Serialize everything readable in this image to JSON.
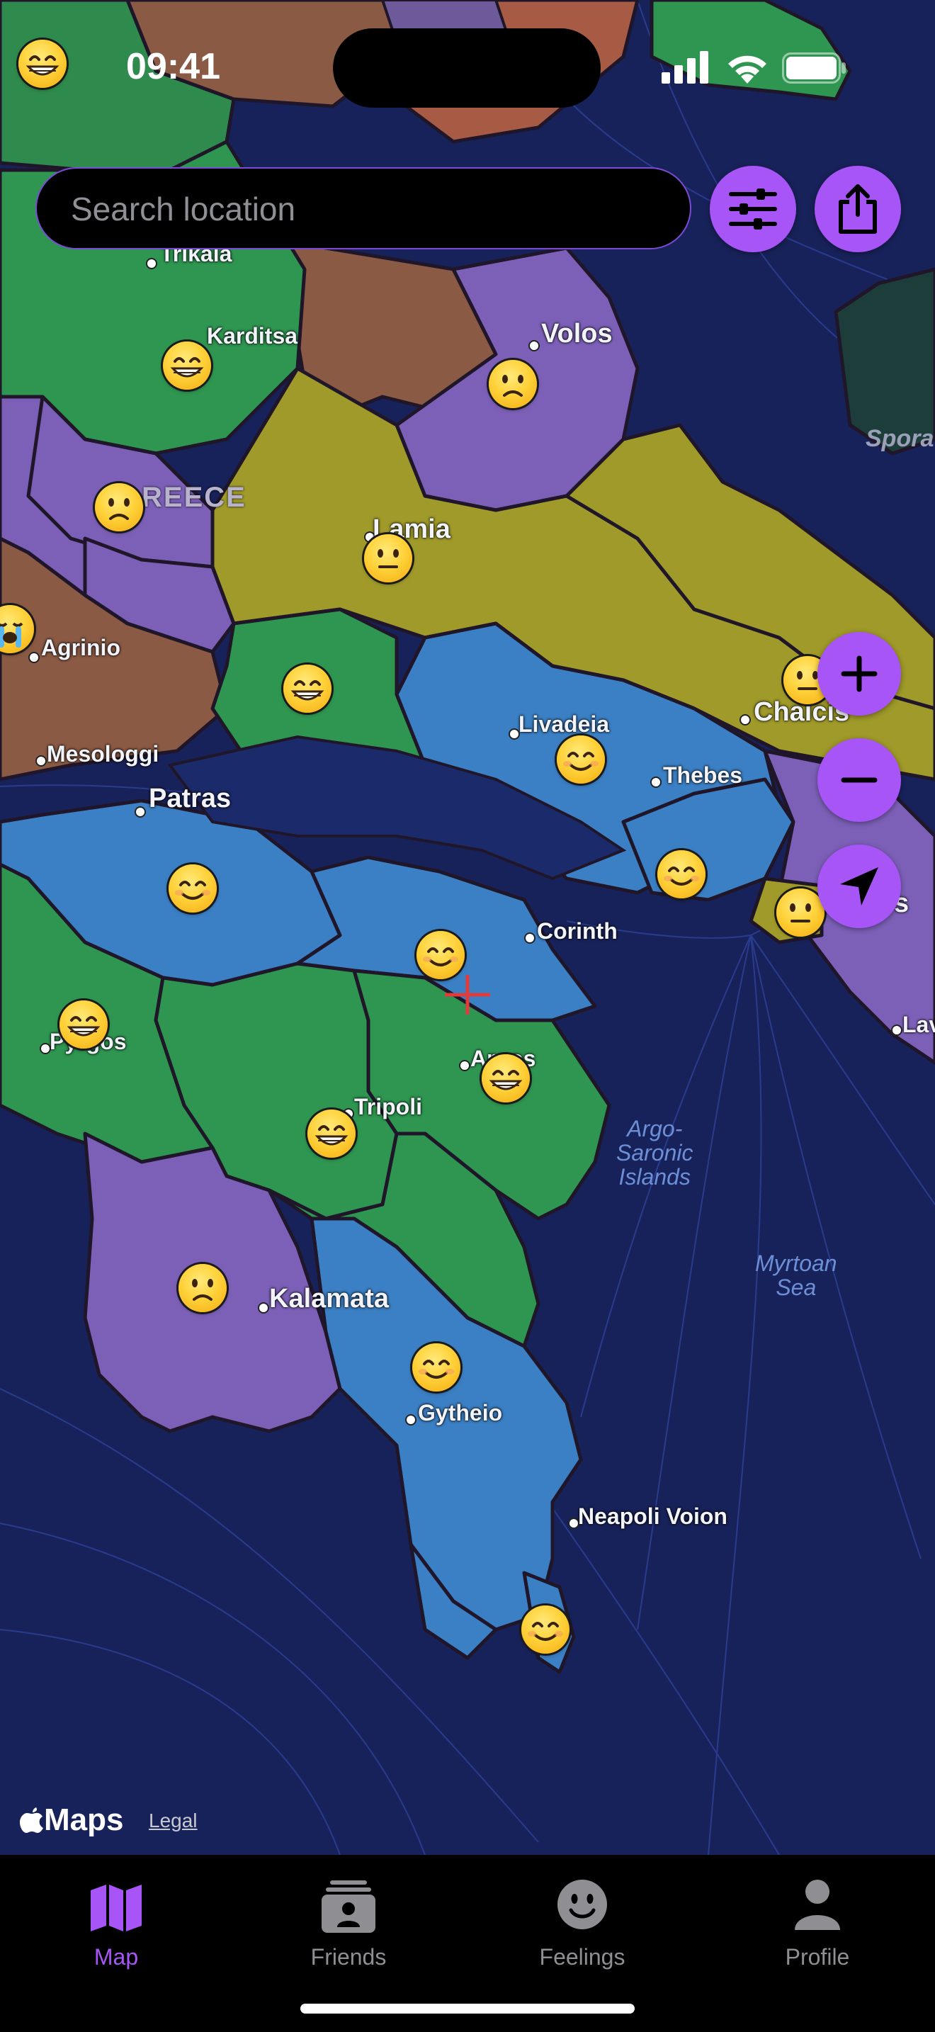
{
  "status_bar": {
    "time": "09:41"
  },
  "search": {
    "placeholder": "Search location",
    "value": ""
  },
  "toolbar": {
    "filters_icon": "sliders-icon",
    "share_icon": "share-icon"
  },
  "map_controls": {
    "zoom_in_icon": "plus-icon",
    "zoom_out_icon": "minus-icon",
    "locate_icon": "location-arrow-icon"
  },
  "map": {
    "country_label": "REECE",
    "places": {
      "trikala": "Trikala",
      "karditsa": "Karditsa",
      "volos": "Volos",
      "lamia": "Lamia",
      "agrinio": "Agrinio",
      "mesologgi": "Mesologgi",
      "livadeia": "Livadeia",
      "chalcis": "Chalcis",
      "thebes": "Thebes",
      "patras": "Patras",
      "corinth": "Corinth",
      "pyrgos": "Pyrgos",
      "argos": "Argos",
      "tripoli": "Tripoli",
      "kalamata": "Kalamata",
      "gytheio": "Gytheio",
      "neapoli": "Neapoli Voion",
      "lavrio": "Lav",
      "athens_partial": "s"
    },
    "seas": {
      "saronic": "Argo-\nSaronic\nIslands",
      "myrtoan": "Myrtoan\nSea",
      "sporades": "Spora"
    },
    "mood_icons": [
      "grinning-face-icon",
      "slightly-smiling-face-icon",
      "neutral-face-icon",
      "slightly-frowning-face-icon",
      "crying-face-icon"
    ]
  },
  "attribution": {
    "maps": "Maps",
    "legal": "Legal"
  },
  "tabs": [
    {
      "label": "Map",
      "icon": "map-icon",
      "active": true
    },
    {
      "label": "Friends",
      "icon": "friends-icon",
      "active": false
    },
    {
      "label": "Feelings",
      "icon": "feelings-icon",
      "active": false
    },
    {
      "label": "Profile",
      "icon": "profile-icon",
      "active": false
    }
  ],
  "colors": {
    "accent": "#a855f7",
    "sea": "#1a2560",
    "tab_inactive": "#8e8e93"
  }
}
